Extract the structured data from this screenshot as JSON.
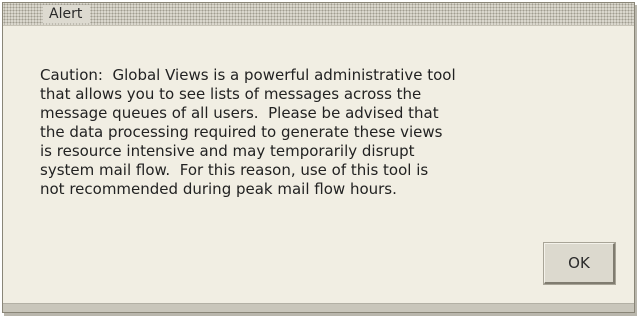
{
  "dialog": {
    "title": "Alert",
    "message": "Caution:  Global Views is a powerful administrative tool\nthat allows you to see lists of messages across the\nmessage queues of all users.  Please be advised that\nthe data processing required to generate these views\nis resource intensive and may temporarily disrupt\nsystem mail flow.  For this reason, use of this tool is\nnot recommended during peak mail flow hours.",
    "ok_label": "OK"
  }
}
